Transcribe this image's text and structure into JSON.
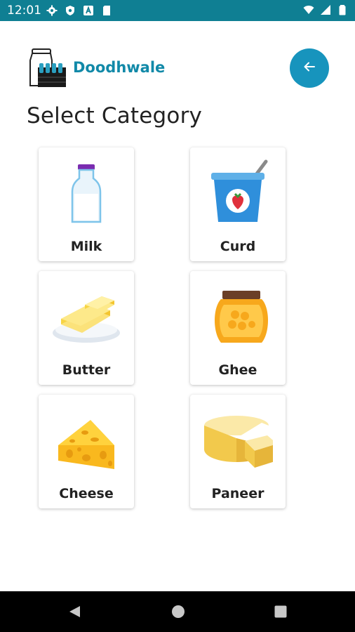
{
  "status_bar": {
    "time": "12:01",
    "left_icons": [
      "settings-icon",
      "shield-icon",
      "a-icon",
      "sd-card-icon"
    ],
    "right_icons": [
      "wifi-icon",
      "signal-icon",
      "battery-icon"
    ],
    "background_color": "#0f7f93"
  },
  "header": {
    "app_name": "Doodhwale",
    "logo_icon": "milk-crate-logo",
    "back_icon": "arrow-left-icon",
    "accent_color": "#1794bd"
  },
  "page": {
    "title": "Select Category"
  },
  "categories": [
    {
      "label": "Milk",
      "icon": "milk-bottle-icon"
    },
    {
      "label": "Curd",
      "icon": "curd-cup-icon"
    },
    {
      "label": "Butter",
      "icon": "butter-icon"
    },
    {
      "label": "Ghee",
      "icon": "ghee-jar-icon"
    },
    {
      "label": "Cheese",
      "icon": "cheese-icon"
    },
    {
      "label": "Paneer",
      "icon": "paneer-icon"
    }
  ],
  "nav_bar": {
    "icons": [
      "nav-back-icon",
      "nav-home-icon",
      "nav-recents-icon"
    ]
  }
}
